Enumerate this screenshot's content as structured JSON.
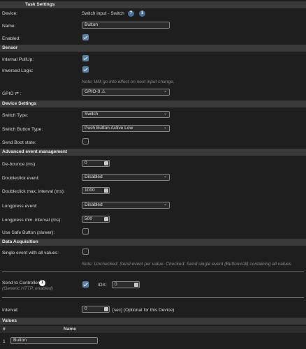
{
  "task_settings": {
    "header": "Task Settings",
    "device_label": "Device:",
    "device_value": "Switch input - Switch",
    "help_badge": "?",
    "info_badge": "ℹ",
    "name_label": "Name:",
    "name_value": "Button",
    "enabled_label": "Enabled:",
    "enabled": true
  },
  "sensor": {
    "header": "Sensor",
    "pullup_label": "Internal PullUp:",
    "pullup": true,
    "inversed_label": "Inversed Logic:",
    "inversed": true,
    "note": "Note: Will go into effect on next input change.",
    "gpio_label": "GPIO ⇄ :",
    "gpio_value": "GPIO-0 ⚠"
  },
  "device_settings": {
    "header": "Device Settings",
    "switch_type_label": "Switch Type:",
    "switch_type_value": "Switch",
    "button_type_label": "Switch Button Type:",
    "button_type_value": "Push Button Active Low",
    "boot_state_label": "Send Boot state:",
    "boot_state": false
  },
  "advanced": {
    "header": "Advanced event management",
    "debounce_label": "De-bounce (ms):",
    "debounce_value": "0",
    "doubleclick_label": "Doubleclick event:",
    "doubleclick_value": "Disabled",
    "dc_interval_label": "Doubleclick max. interval (ms):",
    "dc_interval_value": "1000",
    "longpress_label": "Longpress event:",
    "longpress_value": "Disabled",
    "lp_interval_label": "Longpress min. interval (ms):",
    "lp_interval_value": "500",
    "safe_button_label": "Use Safe Button (slower):",
    "safe_button": false
  },
  "data_acquisition": {
    "header": "Data Acquisition",
    "single_event_label": "Single event with all values:",
    "single_event": false,
    "note": "Note: Unchecked: Send event per value. Checked: Send single event (Button#All) containing all values",
    "controller_label": "Send to Controller",
    "controller_badge": "1",
    "controller_sub": "(Generic HTTP, enabled)",
    "controller_enabled": true,
    "idx_label": "IDX:",
    "idx_value": "0",
    "interval_label": "Interval:",
    "interval_value": "0",
    "interval_suffix": "[sec] (Optional for this Device)"
  },
  "values": {
    "header": "Values",
    "col_num": "#",
    "col_name": "Name",
    "rows": [
      {
        "num": "1",
        "name": "Button"
      }
    ]
  },
  "colors": {
    "header_bg": "#3a3a3a",
    "checkbox_on": "#5a7fa8",
    "badge_blue": "#4a6e96"
  }
}
